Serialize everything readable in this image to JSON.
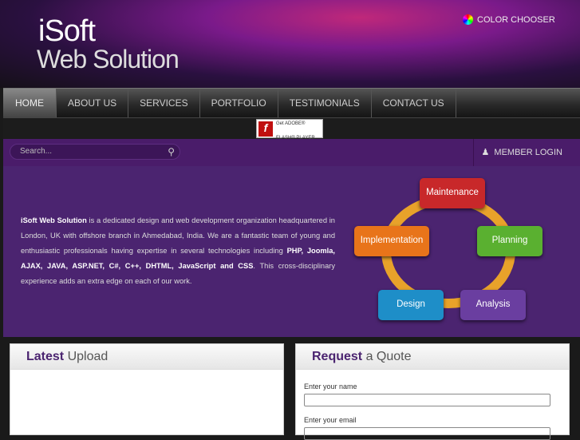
{
  "header": {
    "logo_line1": "iSoft",
    "logo_line2": "Web Solution",
    "color_chooser": "COLOR CHOOSER"
  },
  "nav": [
    "HOME",
    "ABOUT US",
    "SERVICES",
    "PORTFOLIO",
    "TESTIMONIALS",
    "CONTACT US"
  ],
  "flash": {
    "line1": "Get ADOBE®",
    "line2": "FLASH® PLAYER"
  },
  "search": {
    "placeholder": "Search..."
  },
  "member_login": "MEMBER LOGIN",
  "intro": {
    "brand": "iSoft Web Solution",
    "text1": " is a dedicated design and web development organization headquartered in London, UK with offshore branch in Ahmedabad, India. We are a fantastic team of young and enthusiastic professionals having expertise in several technologies including ",
    "tech": "PHP, Joomla, AJAX, JAVA, ASP.NET, C#, C++, DHTML, JavaScript and CSS",
    "text2": ". This cross-disciplinary experience adds an extra edge on each of our work."
  },
  "cycle": {
    "maintenance": "Maintenance",
    "planning": "Planning",
    "analysis": "Analysis",
    "design": "Design",
    "implementation": "Implementation",
    "colors": {
      "maintenance": "#c8282a",
      "planning": "#5ab030",
      "analysis": "#6a3ea0",
      "design": "#1e8ec8",
      "implementation": "#e8741a"
    }
  },
  "latest": {
    "bold": "Latest",
    "rest": " Upload"
  },
  "quote": {
    "bold": "Request",
    "rest": " a Quote",
    "name_label": "Enter your name",
    "email_label": "Enter your email"
  }
}
